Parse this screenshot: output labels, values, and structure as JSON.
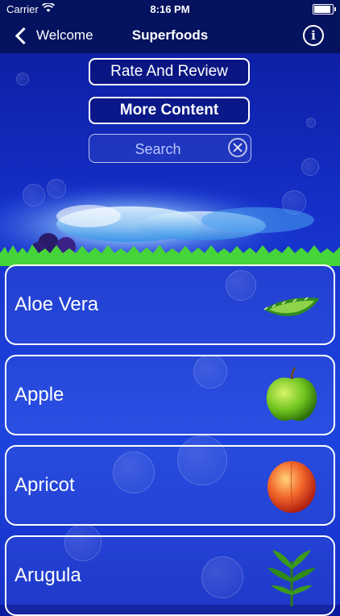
{
  "status": {
    "carrier": "Carrier",
    "time": "8:16 PM"
  },
  "nav": {
    "back_label": "Welcome",
    "title": "Superfoods",
    "info_label": "i"
  },
  "buttons": {
    "rate": "Rate And Review",
    "more": "More Content"
  },
  "search": {
    "placeholder": "Search"
  },
  "items": [
    {
      "label": "Aloe Vera",
      "icon": "aloe-vera-icon"
    },
    {
      "label": "Apple",
      "icon": "apple-icon"
    },
    {
      "label": "Apricot",
      "icon": "apricot-icon"
    },
    {
      "label": "Arugula",
      "icon": "arugula-icon"
    }
  ]
}
